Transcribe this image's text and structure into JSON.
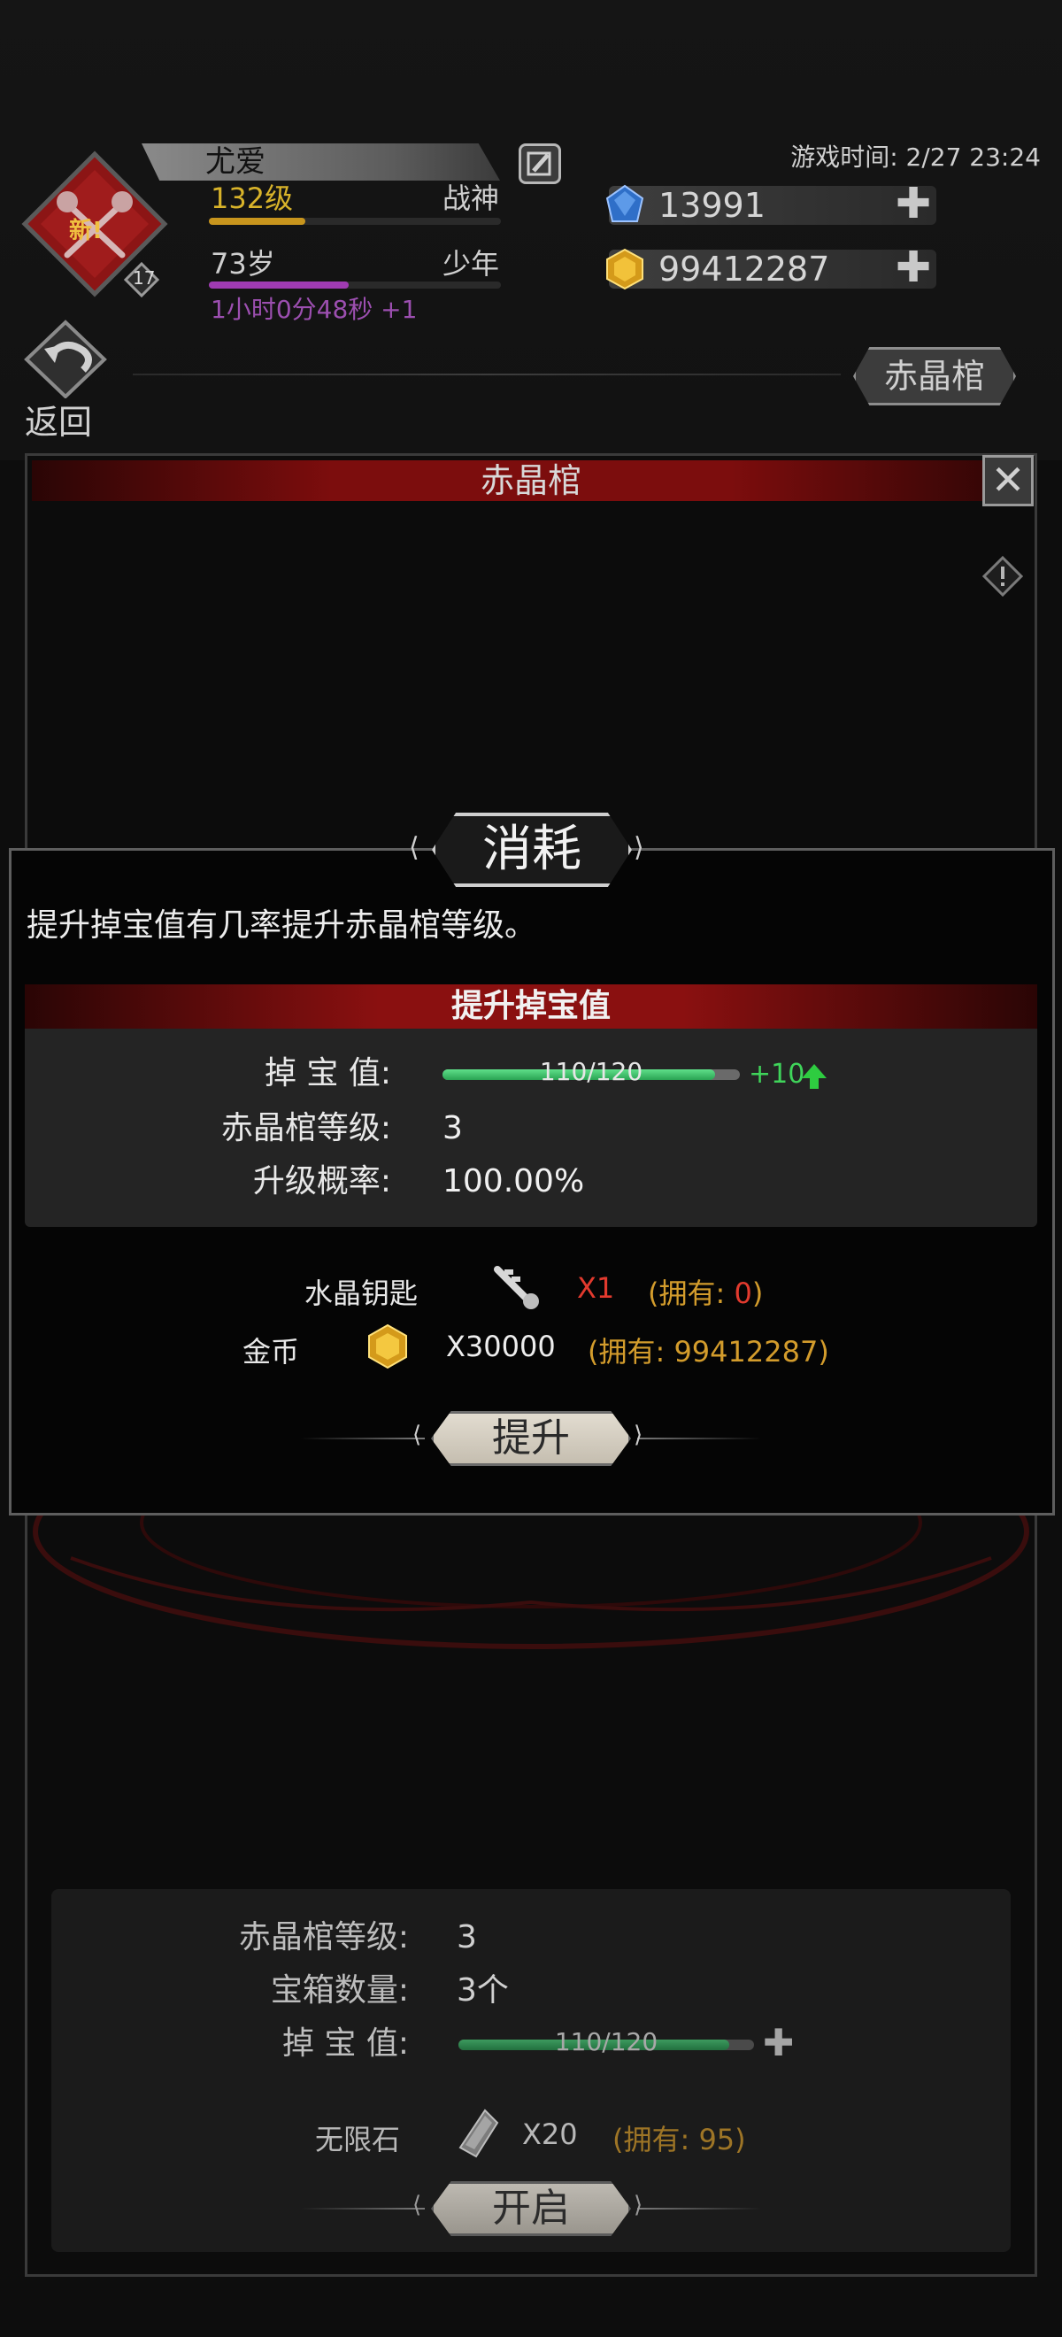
{
  "header": {
    "player_name": "尤爱",
    "level": "132级",
    "title": "战神",
    "age": "73岁",
    "age_stage": "少年",
    "timer": "1小时0分48秒 +1",
    "emblem_badge": "新!",
    "emblem_level": "17",
    "game_time": "游戏时间: 2/27 23:24",
    "currency_gems": "13991",
    "currency_gold": "99412287",
    "level_progress": 0.33,
    "age_progress": 0.48
  },
  "nav": {
    "return_label": "返回",
    "page_tag": "赤晶棺"
  },
  "frame": {
    "title": "赤晶棺"
  },
  "dialog": {
    "title": "消耗",
    "description": "提升掉宝值有几率提升赤晶棺等级。",
    "section_title": "提升掉宝值",
    "rows": {
      "drop_label": "掉 宝 值:",
      "drop_value": "110/120",
      "drop_progress": 0.9167,
      "drop_bonus": "+10",
      "coffin_level_label": "赤晶棺等级:",
      "coffin_level_value": "3",
      "upgrade_rate_label": "升级概率:",
      "upgrade_rate_value": "100.00%"
    },
    "costs": [
      {
        "name": "水晶钥匙",
        "qty": "X1",
        "owned_prefix": "(拥有: ",
        "owned_count": "0",
        "owned_suffix": ")"
      },
      {
        "name": "金币",
        "qty": "X30000",
        "owned_text": "(拥有: 99412287)"
      }
    ],
    "upgrade_button": "提升"
  },
  "bottom": {
    "coffin_level_label": "赤晶棺等级:",
    "coffin_level_value": "3",
    "chest_count_label": "宝箱数量:",
    "chest_count_value": "3个",
    "drop_label": "掉 宝 值:",
    "drop_value": "110/120",
    "drop_progress": 0.9167,
    "cost_name": "无限石",
    "cost_qty": "X20",
    "cost_owned": "(拥有: 95)",
    "open_button": "开启"
  }
}
